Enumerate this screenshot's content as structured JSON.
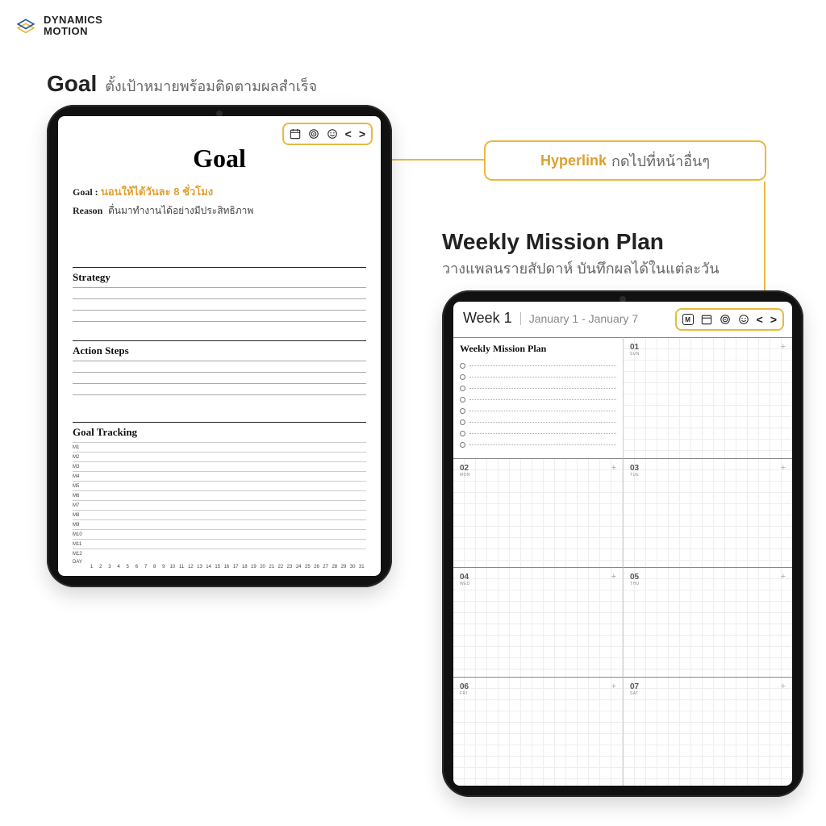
{
  "brand": {
    "line1": "DYNAMICS",
    "line2": "MOTION"
  },
  "titles": {
    "goal_hd": "Goal",
    "goal_sub": "ตั้งเป้าหมายพร้อมติดตามผลสำเร็จ",
    "week_hd": "Weekly Mission Plan",
    "week_sub": "วางแพลนรายสัปดาห์ บันทึกผลได้ในแต่ละวัน"
  },
  "callout": {
    "em": "Hyperlink",
    "rest": "กดไปที่หน้าอื่นๆ"
  },
  "nav": {
    "prev": "<",
    "next": ">"
  },
  "goal_page": {
    "title": "Goal",
    "goal_label": "Goal :",
    "goal_value": "นอนให้ได้วันละ 8 ชั่วโมง",
    "reason_label": "Reason",
    "reason_value": "ตื่นมาทำงานได้อย่างมีประสิทธิภาพ",
    "strategy": "Strategy",
    "action": "Action Steps",
    "tracking": "Goal Tracking",
    "months": [
      "M1",
      "M2",
      "M3",
      "M4",
      "M5",
      "M6",
      "M7",
      "M8",
      "M9",
      "M10",
      "M11",
      "M12"
    ],
    "day_label": "DAY",
    "days": [
      "1",
      "2",
      "3",
      "4",
      "5",
      "6",
      "7",
      "8",
      "9",
      "10",
      "11",
      "12",
      "13",
      "14",
      "15",
      "16",
      "17",
      "18",
      "19",
      "20",
      "21",
      "22",
      "23",
      "24",
      "25",
      "26",
      "27",
      "28",
      "29",
      "30",
      "31"
    ]
  },
  "week_page": {
    "week_lbl": "Week 1",
    "range": "January 1 - January 7",
    "m_badge": "M",
    "wmp_title": "Weekly Mission Plan",
    "days": [
      {
        "n": "01",
        "d": "SUN"
      },
      {
        "n": "02",
        "d": "MON"
      },
      {
        "n": "03",
        "d": "TUE"
      },
      {
        "n": "04",
        "d": "WED"
      },
      {
        "n": "05",
        "d": "THU"
      },
      {
        "n": "06",
        "d": "FRI"
      },
      {
        "n": "07",
        "d": "SAT"
      }
    ]
  }
}
